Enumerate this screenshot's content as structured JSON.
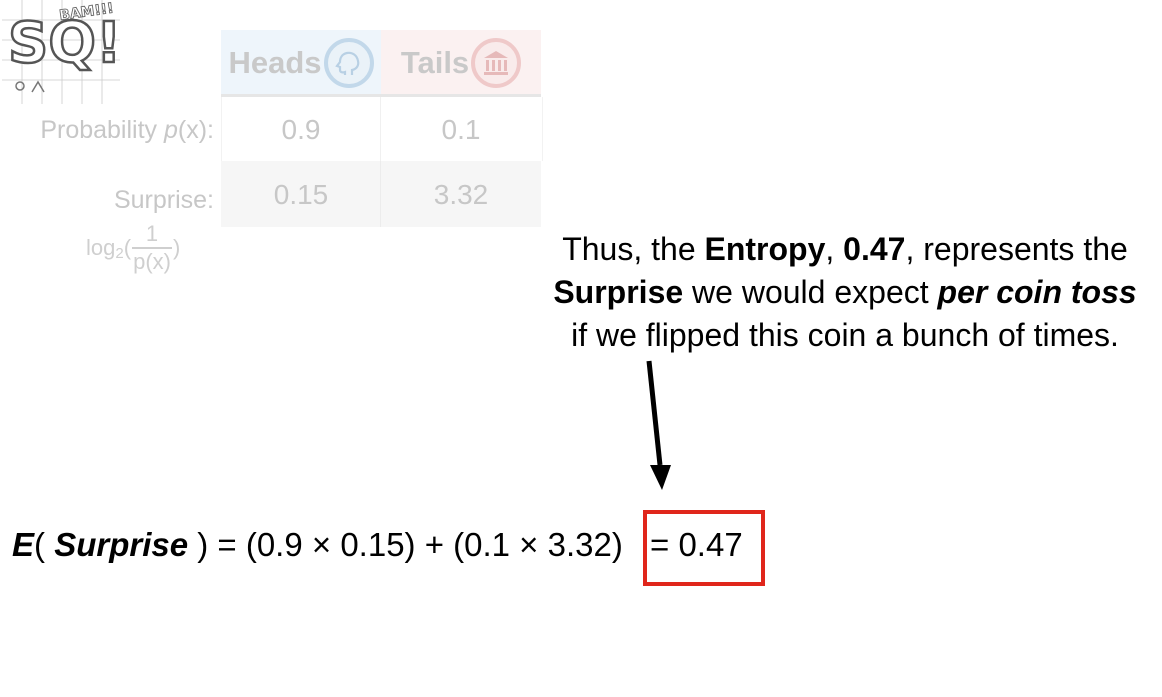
{
  "logo": {
    "text": "SQ!",
    "tagline": "BAM!!!"
  },
  "table": {
    "headers": [
      "Heads",
      "Tails"
    ],
    "coin_icons": [
      "head-profile-icon",
      "building-icon"
    ],
    "rows": [
      {
        "label_pre": "Probability ",
        "label_var": "p",
        "label_post": "(x):",
        "values": [
          "0.9",
          "0.1"
        ]
      },
      {
        "label": "Surprise:",
        "values": [
          "0.15",
          "3.32"
        ]
      }
    ],
    "log_label": {
      "log": "log",
      "base": "2",
      "open": "(",
      "numerator": "1",
      "denominator": "p(x)",
      "close": ")"
    }
  },
  "annotation": {
    "p1": "Thus, the ",
    "b1": "Entropy",
    "p2": ", ",
    "b2": "0.47",
    "p3": ", represents the ",
    "b3": "Surprise",
    "p4": " we would expect ",
    "bi": "per coin toss",
    "p5": " if we flipped this coin a bunch of times."
  },
  "equation": {
    "E": "E",
    "open": "( ",
    "var": "Surprise",
    "rest": " ) = (0.9 × 0.15) + (0.1 × 3.32)",
    "answer": "= 0.47"
  },
  "colors": {
    "answer_box": "#e0261b",
    "heads_bg": "#eef5fb",
    "tails_bg": "#fbf1f1",
    "faded_text": "#c7c7c7"
  }
}
